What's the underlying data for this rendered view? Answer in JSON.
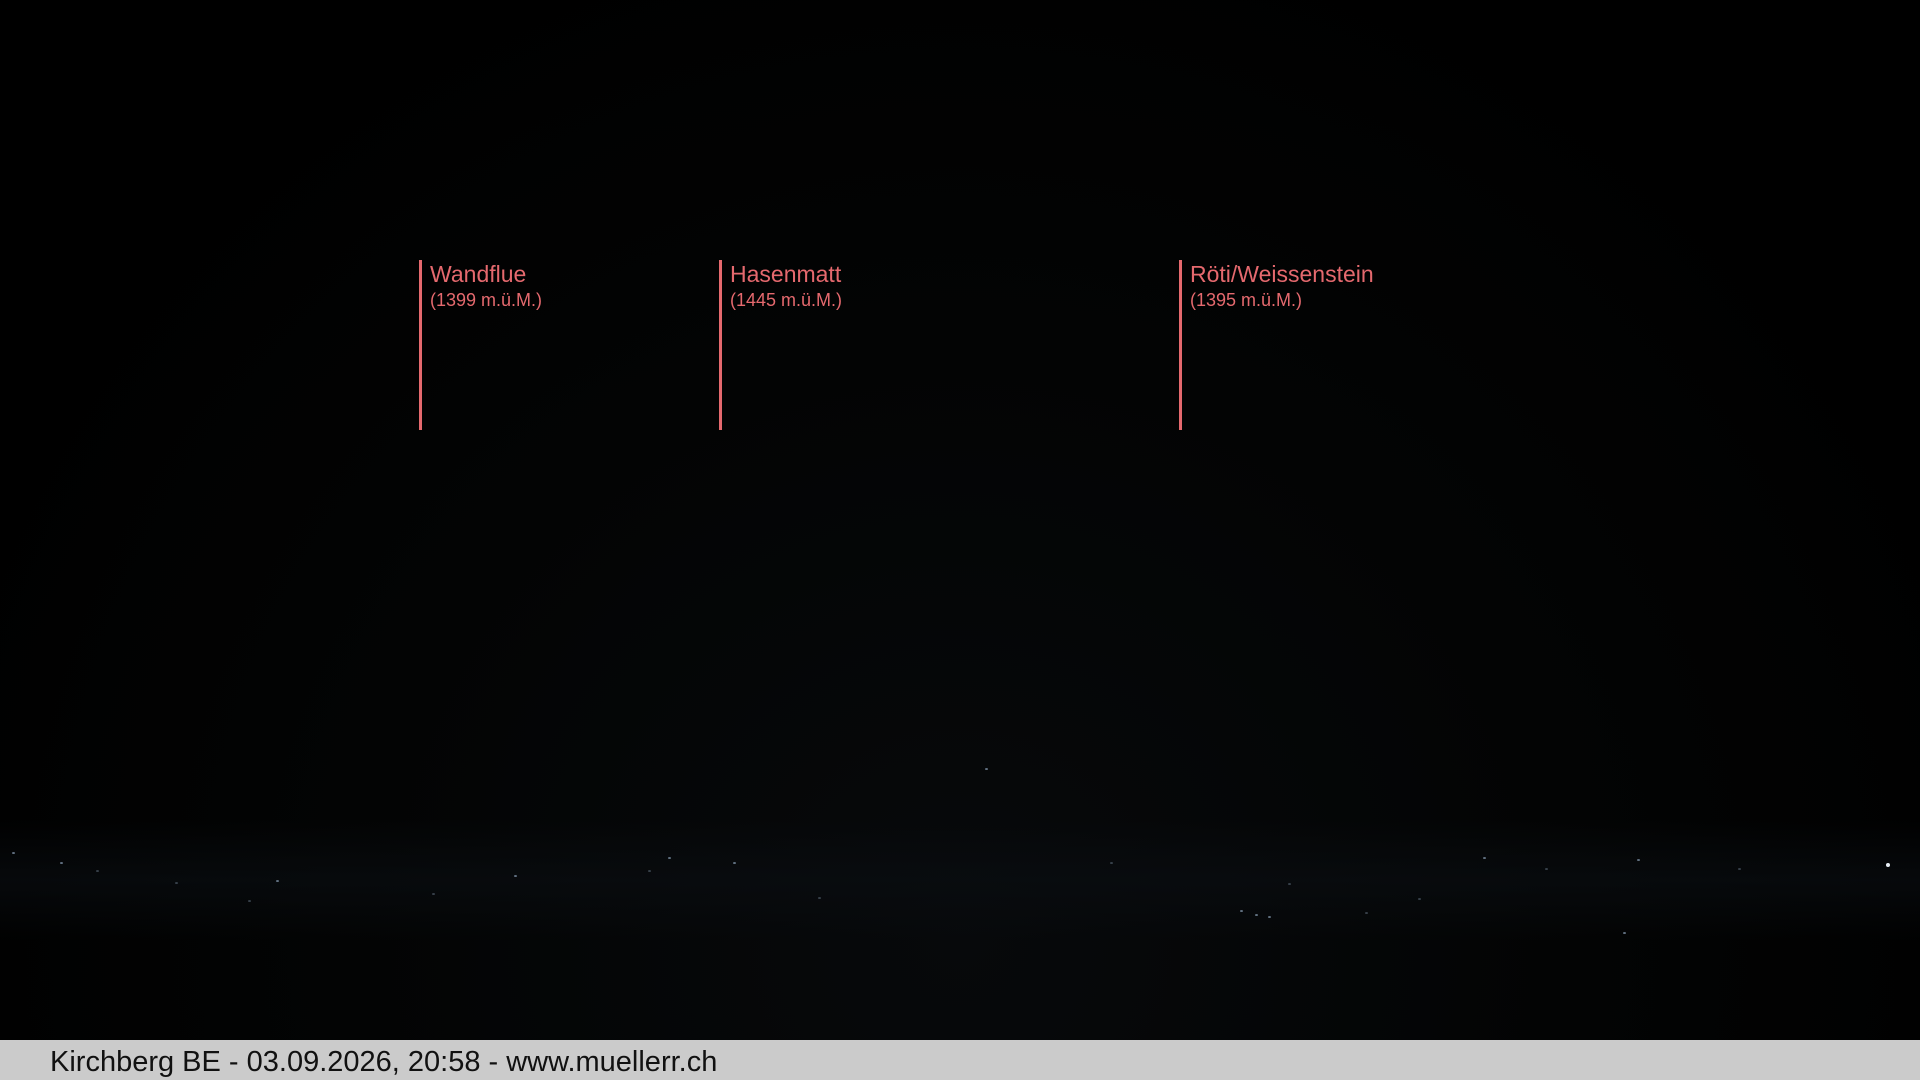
{
  "peaks": [
    {
      "name": "Wandflue",
      "elevation": "(1399 m.ü.M.)"
    },
    {
      "name": "Hasenmatt",
      "elevation": "(1445 m.ü.M.)"
    },
    {
      "name": "Röti/Weissenstein",
      "elevation": "(1395 m.ü.M.)"
    }
  ],
  "footer": {
    "caption": "Kirchberg BE - 03.09.2026, 20:58 - www.muellerr.ch"
  },
  "colors": {
    "marker": "#e5696e",
    "footer_background": "#cbcbcb",
    "footer_text": "#111111",
    "sky": "#000000"
  }
}
